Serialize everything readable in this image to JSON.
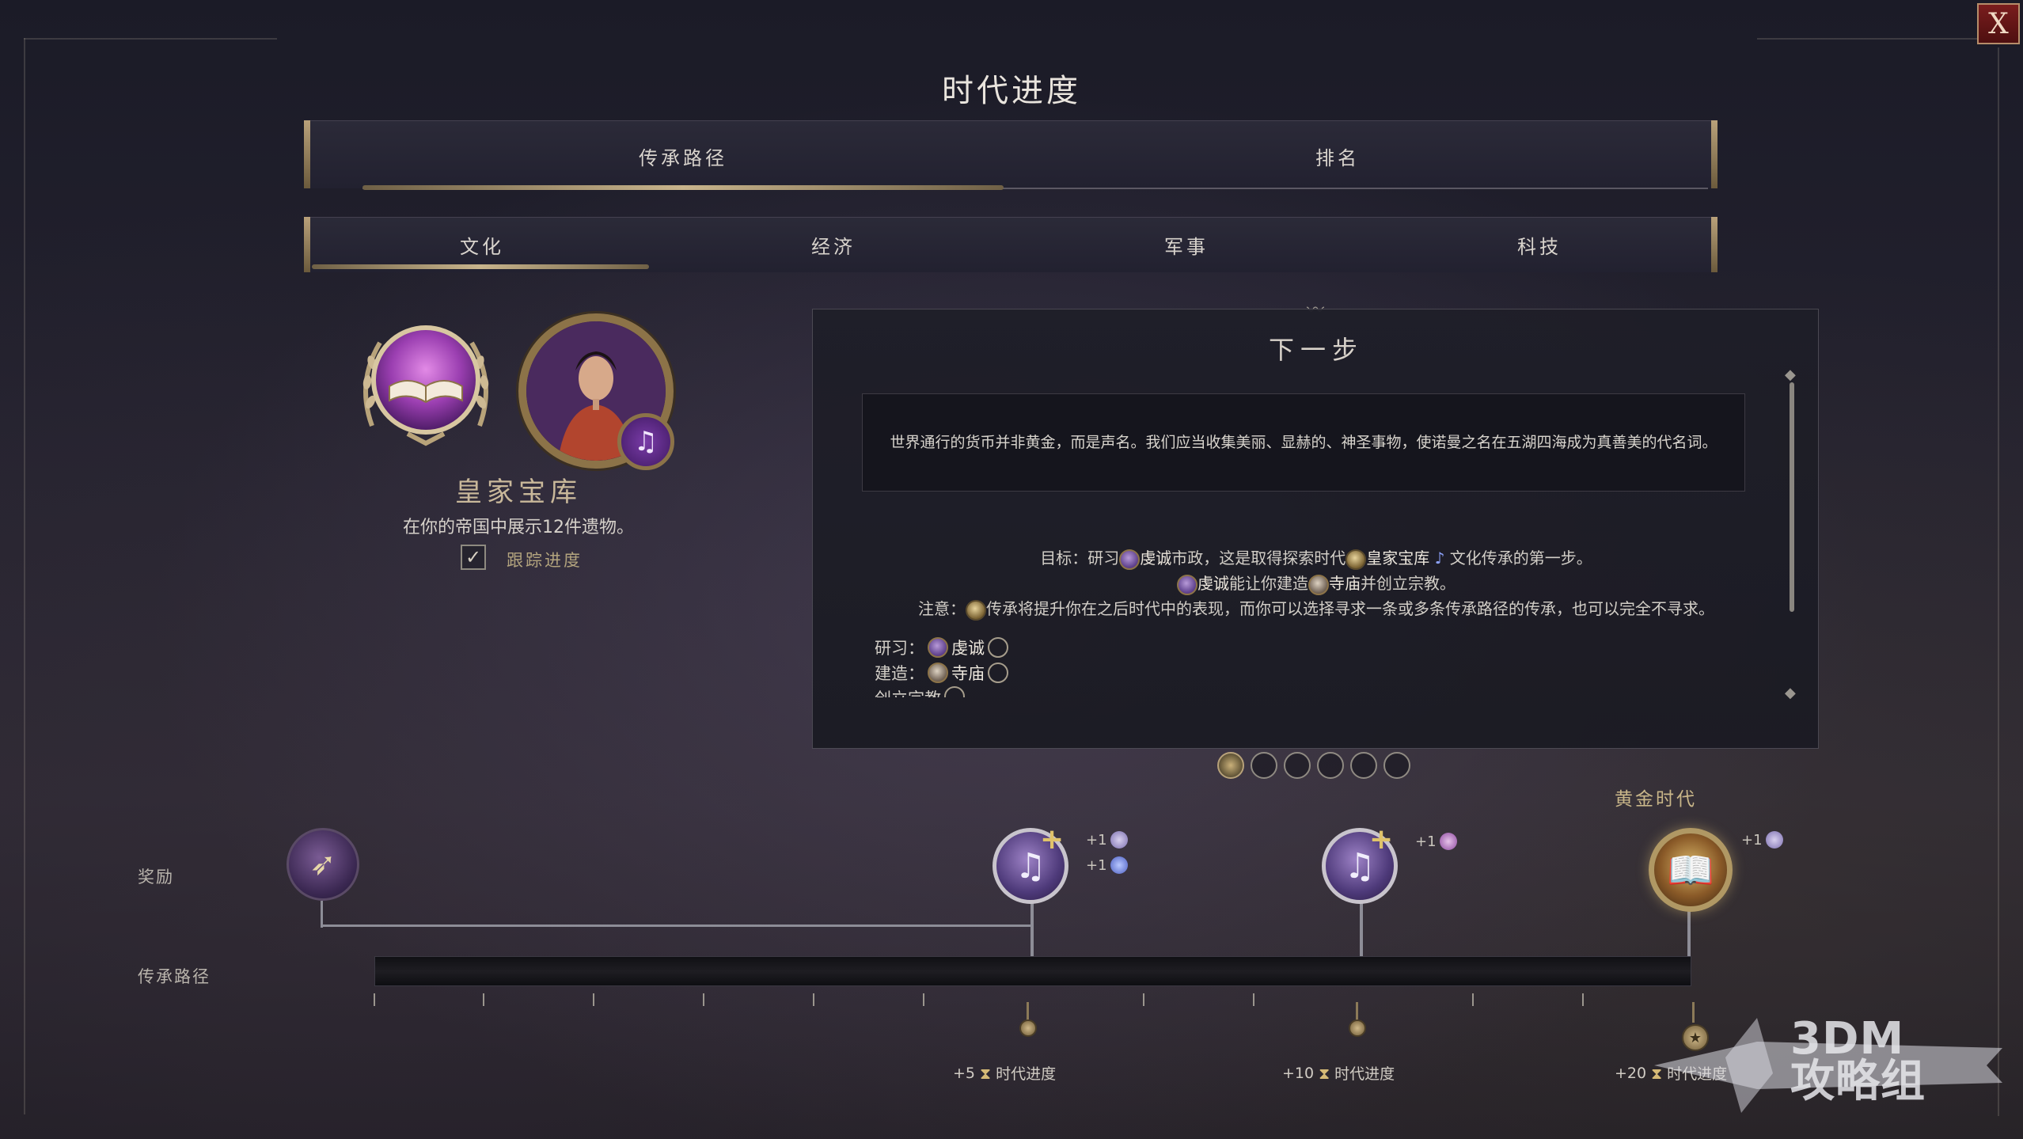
{
  "window": {
    "title": "时代进度",
    "close_label": "X"
  },
  "main_tabs": [
    {
      "label": "传承路径",
      "active": true
    },
    {
      "label": "排名",
      "active": false
    }
  ],
  "category_tabs": [
    {
      "label": "文化",
      "active": true
    },
    {
      "label": "经济",
      "active": false
    },
    {
      "label": "军事",
      "active": false
    },
    {
      "label": "科技",
      "active": false
    }
  ],
  "legacy": {
    "name": "皇家宝库",
    "description": "在你的帝国中展示12件遗物。",
    "track_checked": true,
    "track_label": "跟踪进度",
    "icon": "open-book-icon",
    "leader_badge_icon": "music-note-icon"
  },
  "next_step": {
    "title": "下一步",
    "quote": "世界通行的货币并非黄金，而是声名。我们应当收集美丽、显赫的、神圣事物，使诺曼之名在五湖四海成为真善美的代名词。",
    "goal_prefix": "目标：研习",
    "goal_civic": "虔诚",
    "goal_mid": "市政，这是取得探索时代",
    "goal_legacy": "皇家宝库",
    "goal_suffix": "文化传承的第一步。",
    "line2_a": "虔诚",
    "line2_b": "能让你建造",
    "line2_c": "寺庙",
    "line2_d": "并创立宗教。",
    "note_prefix": "注意：",
    "note_text": "传承将提升你在之后时代中的表现，而你可以选择寻求一条或多条传承路径的传承，也可以完全不寻求。",
    "requirements": [
      {
        "label": "研习：",
        "item": "虔诚",
        "icon": "civic-icon"
      },
      {
        "label": "建造：",
        "item": "寺庙",
        "icon": "temple-icon"
      },
      {
        "label": "创立宗教",
        "item": "",
        "icon": ""
      }
    ]
  },
  "pager": {
    "count": 6,
    "active_index": 0
  },
  "timeline": {
    "reward_label": "奖励",
    "path_label": "传承路径",
    "golden_age_label": "黄金时代",
    "milestones": [
      {
        "bonuses": [
          "+1",
          "+1"
        ],
        "age_progress": "+5",
        "age_label": "时代进度"
      },
      {
        "bonuses": [
          "+1"
        ],
        "age_progress": "+10",
        "age_label": "时代进度"
      },
      {
        "bonuses": [
          "+1"
        ],
        "age_progress": "+20",
        "age_label": "时代进度"
      }
    ],
    "progress": 0
  },
  "watermark": {
    "text_line1": "3DM",
    "text_line2": "攻略组"
  },
  "colors": {
    "accent_gold": "#c8b48c",
    "legacy_purple": "#7a3ca8",
    "close_red": "#7a1d1d"
  }
}
